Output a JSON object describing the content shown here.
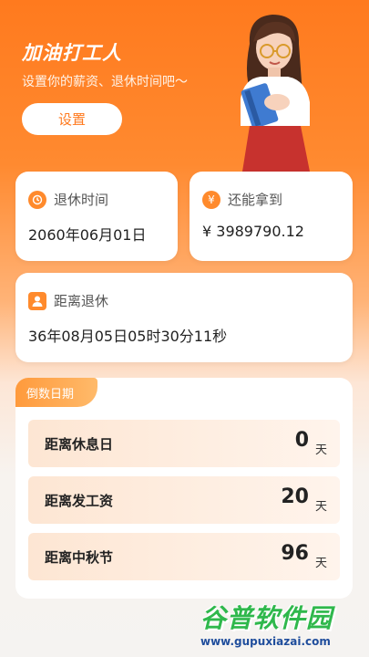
{
  "header": {
    "title": "加油打工人",
    "subtitle": "设置你的薪资、退休时间吧～",
    "setup_label": "设置"
  },
  "cards": {
    "retire_time": {
      "icon": "clock-icon",
      "label": "退休时间",
      "value": "2060年06月01日"
    },
    "earnings": {
      "icon": "yen-icon",
      "label": "还能拿到",
      "value": "¥ 3989790.12"
    },
    "until_retire": {
      "icon": "person-icon",
      "label": "距离退休",
      "value": "36年08月05日05时30分11秒"
    }
  },
  "countdown": {
    "tag": "倒数日期",
    "rows": [
      {
        "label": "距离休息日",
        "value": "0",
        "unit": "天"
      },
      {
        "label": "距离发工资",
        "value": "20",
        "unit": "天"
      },
      {
        "label": "距离中秋节",
        "value": "96",
        "unit": "天"
      }
    ]
  },
  "watermark": {
    "title": "谷普软件园",
    "url": "www.gupuxiazai.com"
  },
  "colors": {
    "accent": "#ff7a1e",
    "icon": "#ff8a2c",
    "watermark_green": "#2fb84c",
    "watermark_blue": "#1f4d9c"
  }
}
